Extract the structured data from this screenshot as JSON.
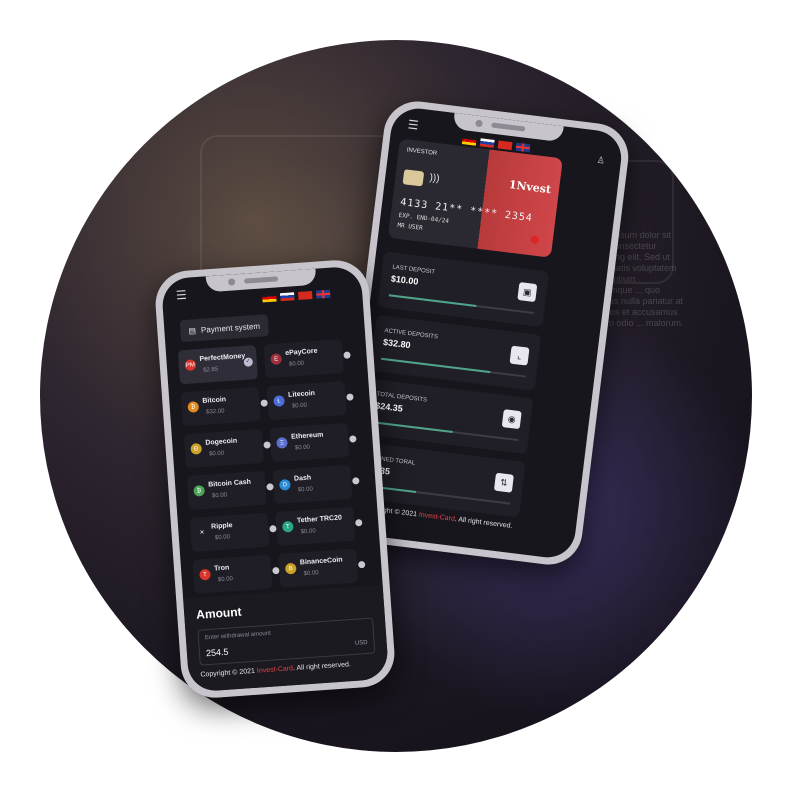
{
  "payment_phone": {
    "payment_button_label": "Payment system",
    "coins": [
      {
        "name": "PerfectMoney",
        "balance": "$2.85",
        "icon_letter": "PM",
        "color": "#d9352b",
        "selected": true
      },
      {
        "name": "ePayCore",
        "balance": "$0.00",
        "icon_letter": "E",
        "color": "#9c2f3b",
        "selected": false
      },
      {
        "name": "Bitcoin",
        "balance": "$32.00",
        "icon_letter": "₿",
        "color": "#e08a1e",
        "selected": false
      },
      {
        "name": "Litecoin",
        "balance": "$0.00",
        "icon_letter": "Ł",
        "color": "#4a6cd4",
        "selected": false
      },
      {
        "name": "Dogecoin",
        "balance": "$0.00",
        "icon_letter": "Ð",
        "color": "#c9a227",
        "selected": false
      },
      {
        "name": "Ethereum",
        "balance": "$0.00",
        "icon_letter": "Ξ",
        "color": "#5b6fcf",
        "selected": false
      },
      {
        "name": "Bitcoin Cash",
        "balance": "$0.00",
        "icon_letter": "₿",
        "color": "#4aa357",
        "selected": false
      },
      {
        "name": "Dash",
        "balance": "$0.00",
        "icon_letter": "D",
        "color": "#2a8ad6",
        "selected": false
      },
      {
        "name": "Ripple",
        "balance": "$0.00",
        "icon_letter": "✕",
        "color": "#1f1e26",
        "selected": false
      },
      {
        "name": "Tether TRC20",
        "balance": "$0.00",
        "icon_letter": "T",
        "color": "#2aa586",
        "selected": false
      },
      {
        "name": "Tron",
        "balance": "$0.00",
        "icon_letter": "T",
        "color": "#d9352b",
        "selected": false
      },
      {
        "name": "BinanceCoin",
        "balance": "$0.00",
        "icon_letter": "B",
        "color": "#c9a227",
        "selected": false
      }
    ],
    "amount_title": "Amount",
    "amount_placeholder": "Enter withdrawal amount",
    "amount_value": "254.5",
    "amount_currency": "USD",
    "copyright_prefix": "Copyright © 2021 ",
    "copyright_brand": "Invest-Card",
    "copyright_suffix": ". All right reserved."
  },
  "dashboard_phone": {
    "card": {
      "label": "INVESTOR",
      "number": "4133 21** **** 2354",
      "expiry": "EXP. END-04/24",
      "holder": "MR USER",
      "logo": "1Nvest"
    },
    "stats": [
      {
        "title": "LAST DEPOSIT",
        "value": "$10.00",
        "icon": "wallet-icon",
        "glyph": "▣",
        "progress": 0.6
      },
      {
        "title": "ACTIVE DEPOSITS",
        "value": "$32.80",
        "icon": "chart-icon",
        "glyph": "⌞",
        "progress": 0.75
      },
      {
        "title": "TOTAL DEPOSITS",
        "value": "$24.35",
        "icon": "money-icon",
        "glyph": "◉",
        "progress": 0.55
      },
      {
        "title": "EARNED TORAL",
        "value": "$6.35",
        "icon": "sort-icon",
        "glyph": "⇅",
        "progress": 0.35
      }
    ],
    "copyright_prefix": "Copyright © 2021 ",
    "copyright_brand": "Invest-Card",
    "copyright_suffix": ". All right reserved."
  },
  "background_text": "Lorem ipsum dolor sit amet, consectetur adipiscing elit. Sed ut perspiciatis voluptatem accusantium doloremque ... quo voluptas nulla pariatur at vero eos et accusamus et iusto odio ... malorum.",
  "accent_color": "#e0454b"
}
